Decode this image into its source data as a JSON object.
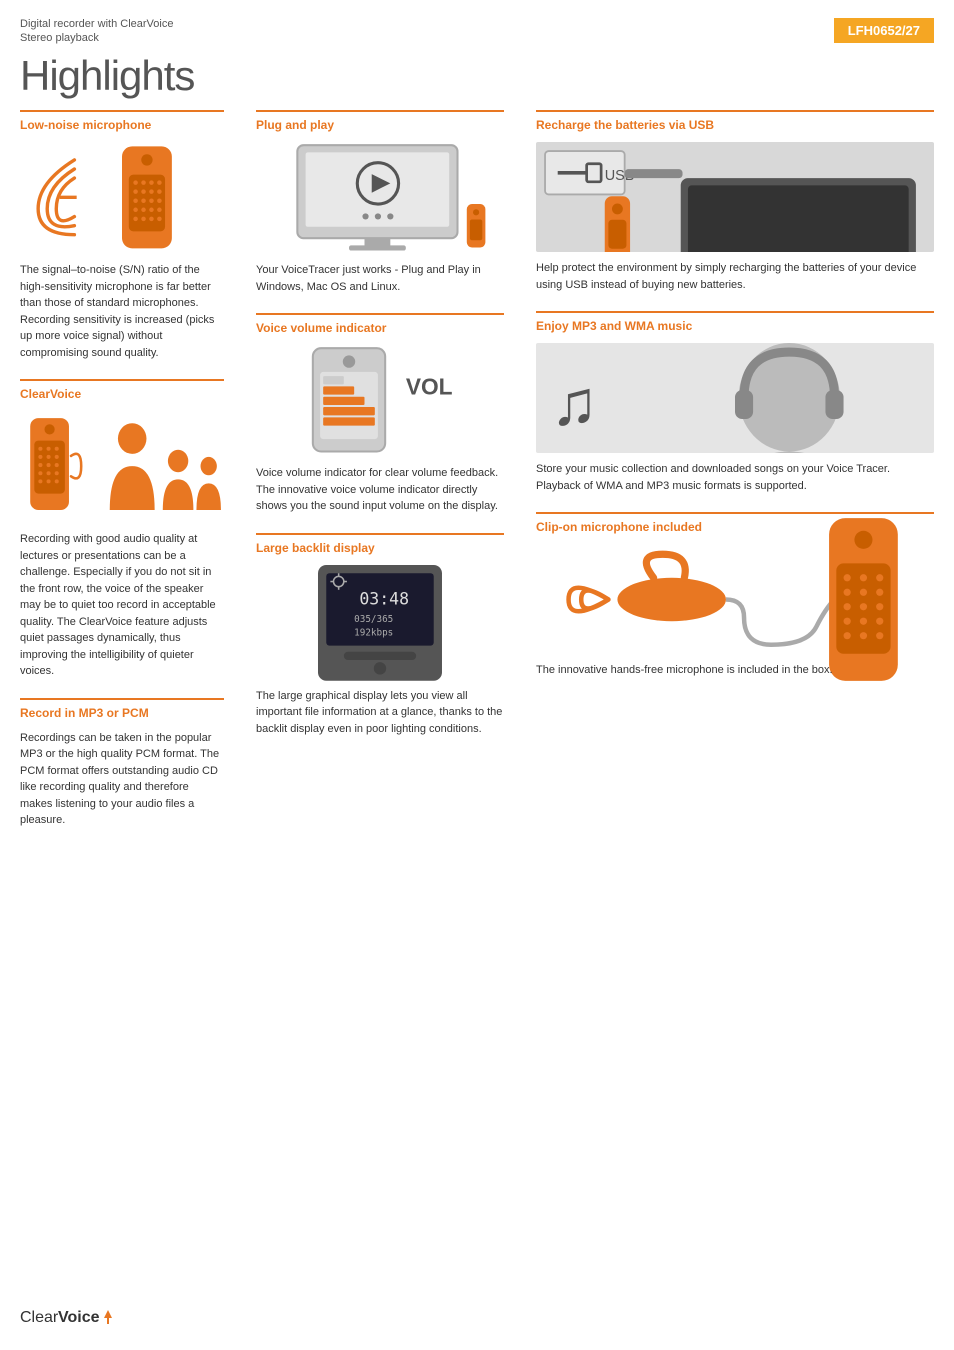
{
  "header": {
    "product_line": "Digital recorder with ClearVoice",
    "product_sub": "Stereo playback",
    "model_number": "LFH0652/27",
    "page_heading": "Highlights"
  },
  "sections": {
    "low_noise": {
      "title": "Low-noise microphone",
      "body": "The signal–to-noise (S/N) ratio of the high-sensitivity microphone is far better than those of standard microphones. Recording sensitivity is increased (picks up more voice signal) without compromising sound quality."
    },
    "clearvoice": {
      "title": "ClearVoice",
      "body": "Recording with good audio quality at lectures or presentations can be a challenge. Especially if you do not sit in the front row, the voice of the speaker may be to quiet too record in acceptable quality. The ClearVoice feature adjusts quiet passages dynamically, thus improving the intelligibility of quieter voices."
    },
    "record_mp3_pcm": {
      "title": "Record in MP3 or PCM",
      "body": "Recordings can be taken in the popular MP3 or the high quality PCM format. The PCM format offers outstanding audio CD like recording quality and therefore makes listening to your audio files a pleasure."
    },
    "plug_play": {
      "title": "Plug and play",
      "body": "Your VoiceTracer just works - Plug and Play in Windows, Mac OS and Linux."
    },
    "voice_volume": {
      "title": "Voice volume indicator",
      "body": "Voice volume indicator for clear volume feedback. The innovative voice volume indicator directly shows you the sound input volume on the display."
    },
    "large_display": {
      "title": "Large backlit display",
      "body": "The large graphical display lets you view all important file information at a glance, thanks to the backlit display even in poor lighting conditions."
    },
    "recharge_usb": {
      "title": "Recharge the batteries via USB",
      "body": "Help protect the environment by simply recharging the batteries of your device using USB instead of buying new batteries.",
      "usb_label": "USB"
    },
    "enjoy_mp3": {
      "title": "Enjoy MP3 and WMA music",
      "body": "Store your music collection and downloaded songs on your Voice Tracer. Playback of WMA and MP3 music formats is supported."
    },
    "clipon": {
      "title": "Clip-on microphone included",
      "body": "The innovative hands-free microphone is included in the box."
    }
  },
  "footer": {
    "brand": "ClearVoice",
    "brand_pre": "Clear",
    "brand_post": "Voice"
  },
  "colors": {
    "accent": "#e87722",
    "text": "#333333",
    "light_gray": "#cccccc"
  }
}
